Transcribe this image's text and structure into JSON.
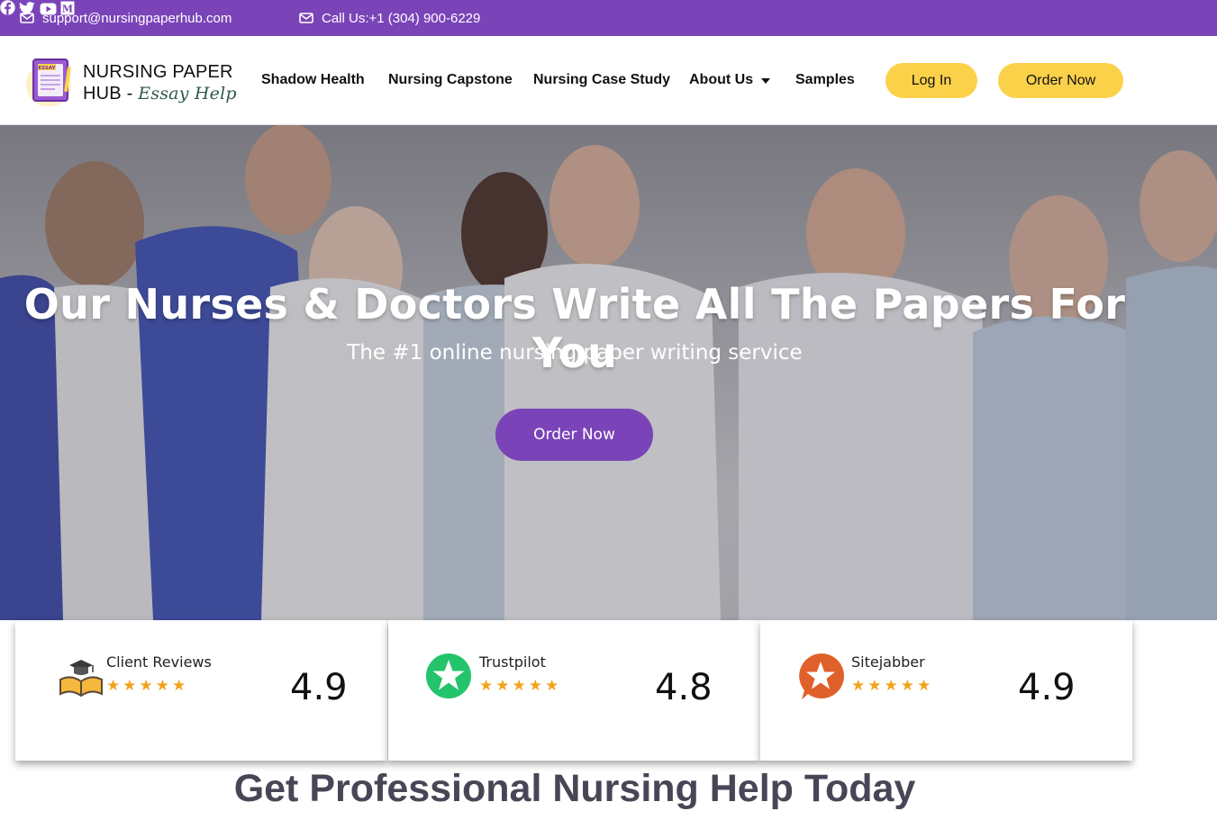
{
  "topbar": {
    "email": "support@nursingpaperhub.com",
    "phone": "Call Us:+1 (304) 900-6229",
    "social_icons": [
      "facebook-icon",
      "twitter-icon",
      "youtube-icon",
      "medium-icon"
    ],
    "background": "#7a44b8"
  },
  "header": {
    "logo_badge": "ESSAY",
    "logo_line1": "NURSING PAPER",
    "logo_line2": "HUB - ",
    "logo_sub": "Essay Help",
    "nav": [
      {
        "label": "Shadow Health"
      },
      {
        "label": "Nursing Capstone"
      },
      {
        "label": "Nursing Case Study"
      },
      {
        "label": "About Us"
      },
      {
        "label": "Samples"
      }
    ],
    "login_label": "Log In",
    "order_label": "Order Now",
    "accent": "#fcd14a"
  },
  "hero": {
    "title": "Our Nurses & Doctors Write All The Papers For You",
    "subtitle": "The #1 online nursing paper writing service",
    "cta_label": "Order Now",
    "cta_color": "#7a44b8"
  },
  "ratings": [
    {
      "name": "Client Reviews",
      "score": "4.9",
      "icon": "graduation-book-icon"
    },
    {
      "name": "Trustpilot",
      "score": "4.8",
      "icon": "trustpilot-star-icon"
    },
    {
      "name": "Sitejabber",
      "score": "4.9",
      "icon": "sitejabber-star-icon"
    }
  ],
  "section": {
    "title": "Get Professional Nursing Help Today"
  }
}
